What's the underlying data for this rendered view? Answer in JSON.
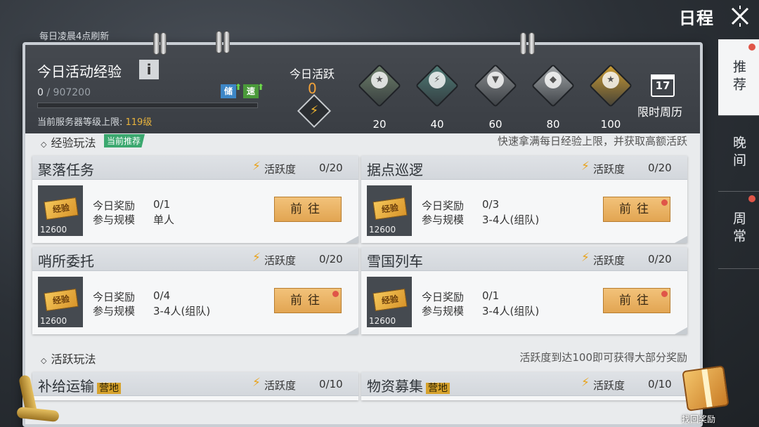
{
  "header": {
    "title": "日程"
  },
  "refresh_note": "每日凌晨4点刷新",
  "side_tabs": [
    {
      "label": "推荐",
      "active": true,
      "dot": true
    },
    {
      "label": "晚间",
      "active": false,
      "dot": false
    },
    {
      "label": "周常",
      "active": false,
      "dot": true
    }
  ],
  "daily_exp": {
    "title": "今日活动经验",
    "info": "i",
    "current": "0",
    "max": "/ 907200",
    "progress": 0.0,
    "boost_store": "储",
    "boost_speed": "速",
    "level_cap_label": "当前服务器等级上限: ",
    "level_cap_value": "119级"
  },
  "activity": {
    "label": "今日活跃",
    "value": "0",
    "rewards": [
      {
        "value": "20",
        "icon": "silver-chest-icon",
        "color": "#6d7f6a"
      },
      {
        "value": "40",
        "icon": "blue-bolt-chest-icon",
        "color": "#4f7b76"
      },
      {
        "value": "60",
        "icon": "orange-emblem-chest-icon",
        "color": "#8a8d90"
      },
      {
        "value": "80",
        "icon": "silver-case-icon",
        "color": "#9fa3a6"
      },
      {
        "value": "100",
        "icon": "gold-chest-icon",
        "color": "#c99b34"
      }
    ],
    "calendar": {
      "day": "17",
      "label": "限时周历"
    }
  },
  "exp_section": {
    "title": "经验玩法",
    "tag": "当前推荐",
    "note": "快速拿满每日经验上限，并获取高额活跃",
    "tasks": [
      {
        "name": "聚落任务",
        "act_label": "活跃度",
        "act": "0/20",
        "reward_label": "今日奖励",
        "reward": "0/1",
        "scale_label": "参与规模",
        "scale": "单人",
        "thumb_label": "经验",
        "thumb_num": "12600",
        "button": "前往",
        "dot": false
      },
      {
        "name": "据点巡逻",
        "act_label": "活跃度",
        "act": "0/20",
        "reward_label": "今日奖励",
        "reward": "0/3",
        "scale_label": "参与规模",
        "scale": "3-4人(组队)",
        "thumb_label": "经验",
        "thumb_num": "12600",
        "button": "前往",
        "dot": true
      },
      {
        "name": "哨所委托",
        "act_label": "活跃度",
        "act": "0/20",
        "reward_label": "今日奖励",
        "reward": "0/4",
        "scale_label": "参与规模",
        "scale": "3-4人(组队)",
        "thumb_label": "经验",
        "thumb_num": "12600",
        "button": "前往",
        "dot": true
      },
      {
        "name": "雪国列车",
        "act_label": "活跃度",
        "act": "0/20",
        "reward_label": "今日奖励",
        "reward": "0/1",
        "scale_label": "参与规模",
        "scale": "3-4人(组队)",
        "thumb_label": "经验",
        "thumb_num": "12600",
        "button": "前往",
        "dot": true
      }
    ]
  },
  "active_section": {
    "title": "活跃玩法",
    "note": "活跃度到达100即可获得大部分奖励",
    "tasks": [
      {
        "name": "补给运输",
        "tag": "营地",
        "act_label": "活跃度",
        "act": "0/10"
      },
      {
        "name": "物资募集",
        "tag": "营地",
        "act_label": "活跃度",
        "act": "0/10"
      }
    ]
  },
  "recover": {
    "label": "找回奖励"
  }
}
